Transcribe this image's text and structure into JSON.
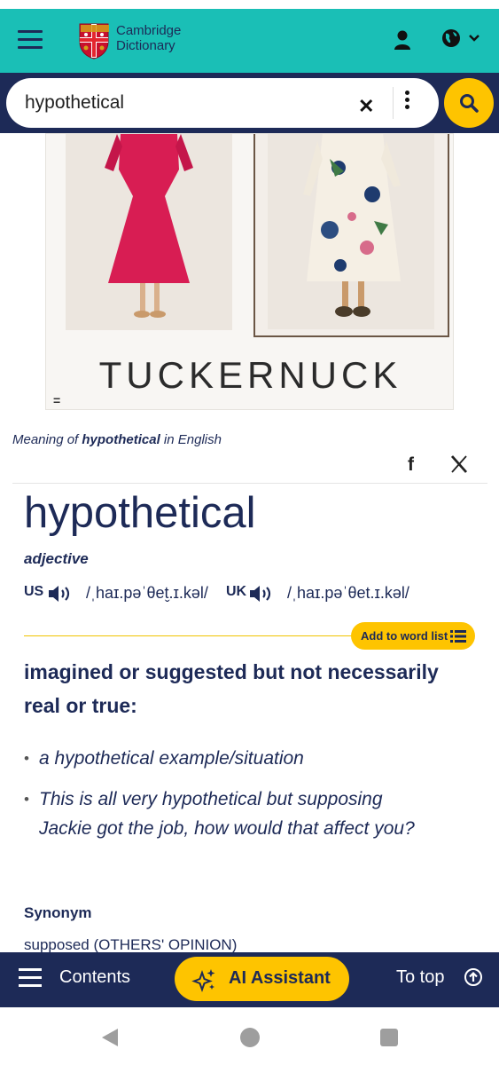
{
  "header": {
    "brand_line1": "Cambridge",
    "brand_line2": "Dictionary",
    "icons": [
      "menu-icon",
      "cambridge-crest-logo",
      "user-icon",
      "globe-icon",
      "chevron-down-icon"
    ]
  },
  "search": {
    "value": "hypothetical",
    "icons": [
      "clear-icon",
      "more-options-icon",
      "search-icon"
    ]
  },
  "ad": {
    "brand": "TUCKERNUCK",
    "badge": "="
  },
  "entry": {
    "meaning_prefix": "Meaning of",
    "meaning_word": "hypothetical",
    "meaning_suffix": "in English",
    "headword": "hypothetical",
    "part_of_speech": "adjective",
    "us_label": "US",
    "us_ipa": "/ˌhaɪ.pəˈθet̬.ɪ.kəl/",
    "uk_label": "UK",
    "uk_ipa": "/ˌhaɪ.pəˈθet.ɪ.kəl/",
    "add_to_word_list": "Add to word list",
    "definition": "imagined or suggested but not necessarily real or true:",
    "examples": [
      "a hypothetical example/situation",
      "This is all very hypothetical but supposing Jackie got the job, how would that affect you?"
    ],
    "bullet": "•",
    "synonym_heading": "Synonym",
    "synonym_value": "supposed (OTHERS' OPINION)"
  },
  "share": {
    "facebook": "f",
    "icons": [
      "facebook-icon",
      "x-icon"
    ]
  },
  "bottom_bar": {
    "contents": "Contents",
    "ai_assistant": "AI Assistant",
    "to_top": "To top"
  },
  "colors": {
    "header_teal": "#1abfb6",
    "navy": "#1d2a57",
    "accent_yellow": "#fec400"
  }
}
